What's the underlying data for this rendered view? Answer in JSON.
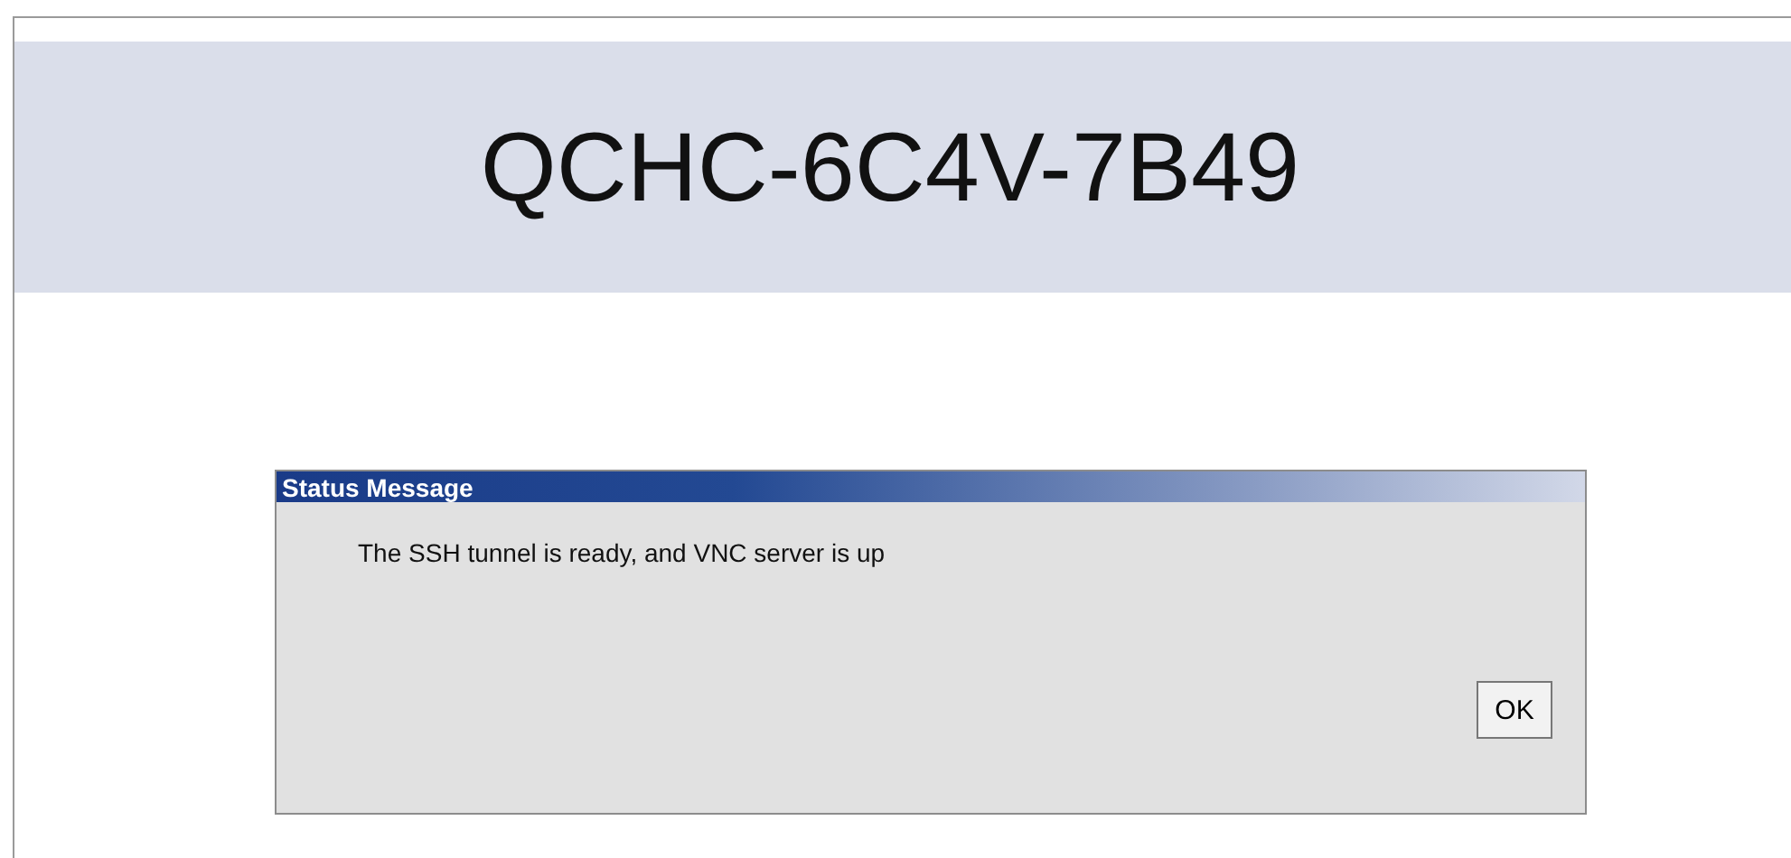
{
  "header": {
    "title": "QCHC-6C4V-7B49"
  },
  "dialog": {
    "title": "Status Message",
    "message": "The SSH tunnel is ready, and VNC server is up",
    "buttons": [
      "OK"
    ]
  }
}
